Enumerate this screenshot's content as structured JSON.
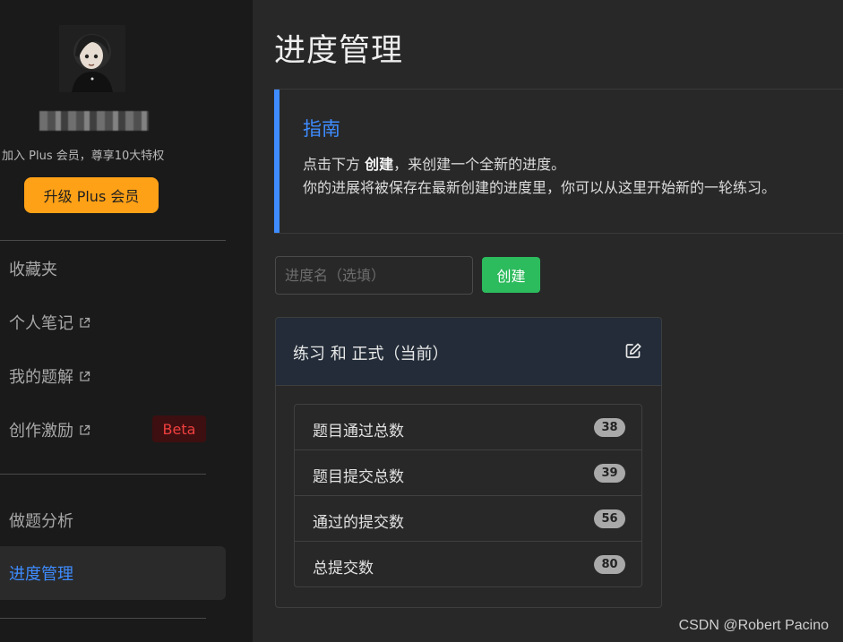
{
  "sidebar": {
    "plus_text": "加入 Plus 会员，尊享10大特权",
    "plus_button": "升级 Plus 会员",
    "items": [
      {
        "label": "收藏夹"
      },
      {
        "label": "个人笔记"
      },
      {
        "label": "我的题解"
      },
      {
        "label": "创作激励",
        "badge": "Beta"
      },
      {
        "label": "做题分析"
      },
      {
        "label": "进度管理"
      }
    ]
  },
  "main": {
    "title": "进度管理",
    "guide": {
      "title": "指南",
      "line1_prefix": "点击下方 ",
      "line1_bold": "创建",
      "line1_suffix": "，来创建一个全新的进度。",
      "line2": "你的进展将被保存在最新创建的进度里，你可以从这里开始新的一轮练习。"
    },
    "input_placeholder": "进度名（选填）",
    "create_button": "创建",
    "card": {
      "title": "练习 和 正式（当前）",
      "stats": [
        {
          "label": "题目通过总数",
          "value": "38"
        },
        {
          "label": "题目提交总数",
          "value": "39"
        },
        {
          "label": "通过的提交数",
          "value": "56"
        },
        {
          "label": "总提交数",
          "value": "80"
        }
      ]
    }
  },
  "watermark": "CSDN @Robert Pacino",
  "colors": {
    "accent_blue": "#3e8cff",
    "plus_orange": "#ffa116",
    "create_green": "#2cbb5d",
    "beta_red": "#ef3f3f"
  }
}
